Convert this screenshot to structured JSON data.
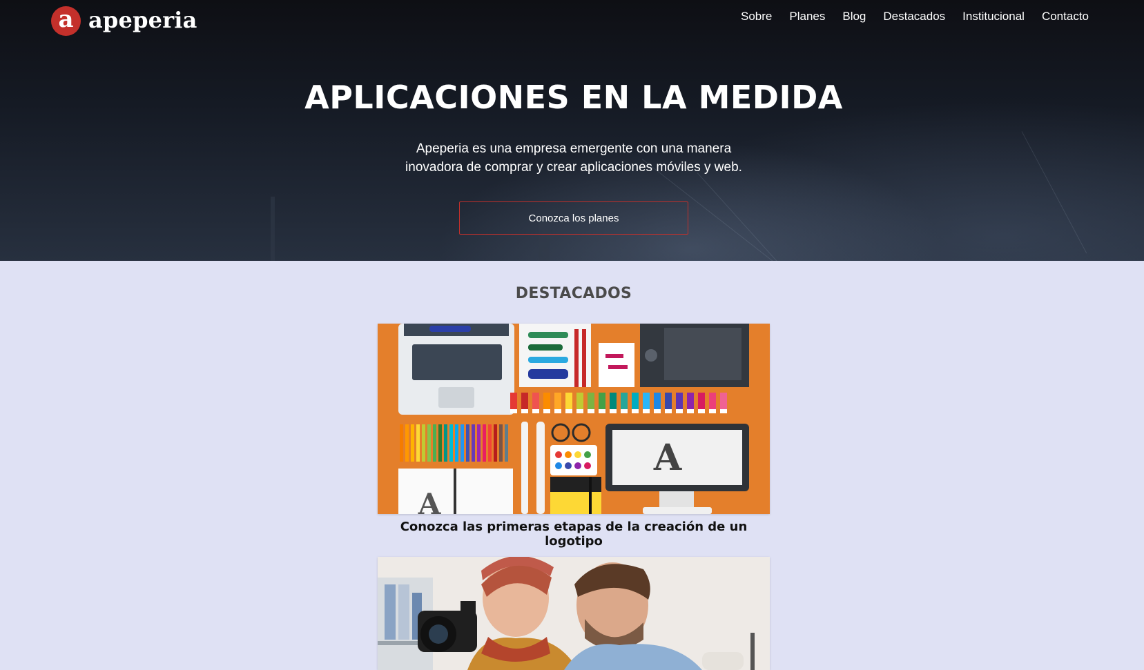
{
  "brand": {
    "mark": "a",
    "name": "apeperia",
    "accent_color": "#c4302b"
  },
  "nav": {
    "items": [
      {
        "label": "Sobre"
      },
      {
        "label": "Planes"
      },
      {
        "label": "Blog"
      },
      {
        "label": "Destacados"
      },
      {
        "label": "Institucional"
      },
      {
        "label": "Contacto"
      }
    ]
  },
  "hero": {
    "title": "APLICACIONES EN LA MEDIDA",
    "text": "Apeperia es una empresa emergente con una manera inovadora de comprar y crear aplicaciones móviles y web.",
    "button_label": "Conozca los planes"
  },
  "featured": {
    "title": "DESTACADOS",
    "background_color": "#dfe1f4",
    "posts": [
      {
        "caption": "Conozca las primeras etapas de la creación de un logotipo",
        "image": "designer-tools-flatlay-illustration"
      },
      {
        "caption": "",
        "image": "photographers-with-camera-photo"
      }
    ]
  }
}
